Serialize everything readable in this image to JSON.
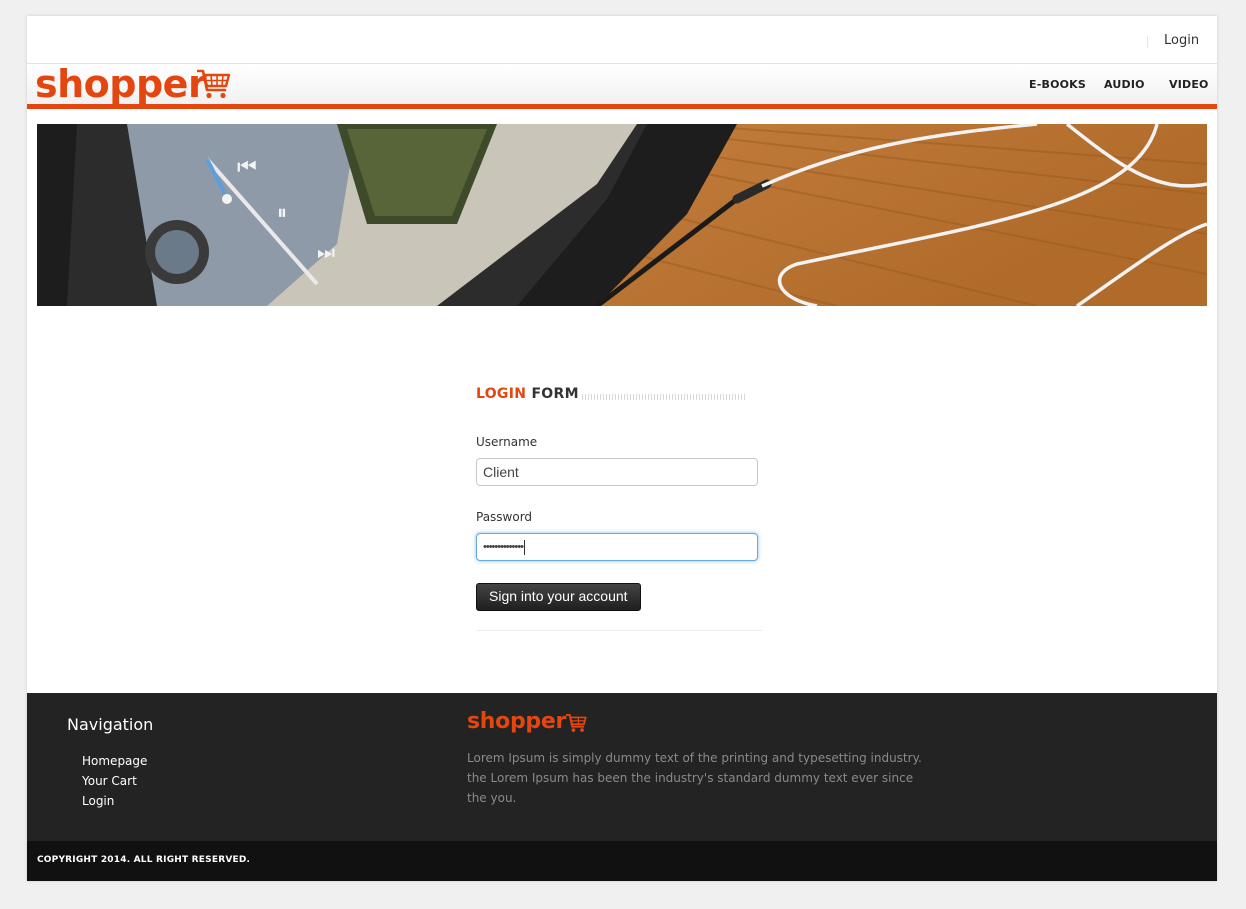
{
  "topbar": {
    "login_label": "Login"
  },
  "brand": {
    "name": "shopper",
    "accent_color": "#e4460f"
  },
  "nav": {
    "items": [
      "E-BOOKS",
      "AUDIO",
      "VIDEO"
    ]
  },
  "banner": {
    "icon": "banner-image"
  },
  "login_form": {
    "title_accent": "LOGIN",
    "title_rest": "FORM",
    "username_label": "Username",
    "username_value": "Client",
    "password_label": "Password",
    "password_value": "••••••••••••••",
    "submit_label": "Sign into your account"
  },
  "footer": {
    "nav_title": "Navigation",
    "nav_items": [
      "Homepage",
      "Your Cart",
      "Login"
    ],
    "brand": "shopper",
    "description": "Lorem Ipsum is simply dummy text of the printing and typesetting industry. the Lorem Ipsum has been the industry's standard dummy text ever since the you.",
    "copyright": "COPYRIGHT 2014. ALL RIGHT RESERVED."
  }
}
